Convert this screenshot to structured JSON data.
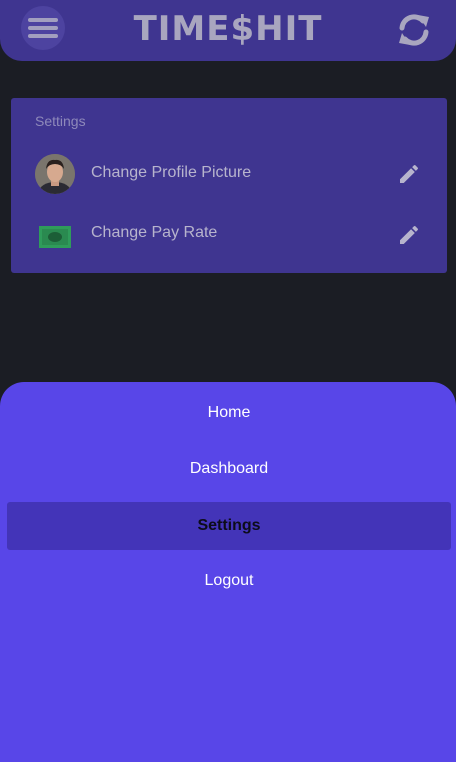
{
  "header": {
    "brand": "TIME$HIT",
    "menu_icon": "hamburger-icon",
    "refresh_icon": "refresh-icon"
  },
  "settings": {
    "title": "Settings",
    "items": [
      {
        "label": "Change Profile Picture",
        "icon": "avatar",
        "action_icon": "pencil-icon"
      },
      {
        "label": "Change Pay Rate",
        "icon": "money-icon",
        "action_icon": "pencil-icon"
      }
    ]
  },
  "nav": {
    "items": [
      {
        "label": "Home",
        "active": false
      },
      {
        "label": "Dashboard",
        "active": false
      },
      {
        "label": "Settings",
        "active": true
      },
      {
        "label": "Logout",
        "active": false
      }
    ]
  },
  "colors": {
    "app_bar": "#3f3590",
    "background": "#1b1d24",
    "drawer": "#5846e8",
    "active_nav": "#4334b8",
    "money_green": "#2f9c5a"
  }
}
